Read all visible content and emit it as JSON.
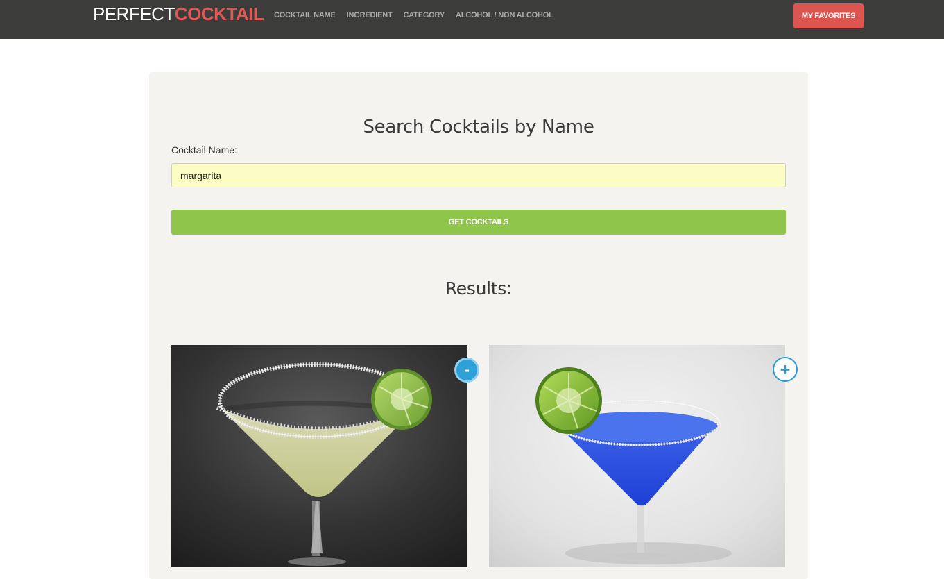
{
  "brand": {
    "part1": "PERFECT",
    "part2": "COCKTAIL"
  },
  "nav": {
    "items": [
      {
        "label": "COCKTAIL NAME"
      },
      {
        "label": "INGREDIENT"
      },
      {
        "label": "CATEGORY"
      },
      {
        "label": "ALCOHOL / NON ALCOHOL"
      }
    ],
    "favorites_label": "MY FAVORITES"
  },
  "search": {
    "title": "Search Cocktails by Name",
    "field_label": "Cocktail Name:",
    "value": "margarita",
    "button_label": "GET COCKTAILS"
  },
  "results": {
    "title": "Results:",
    "cards": [
      {
        "favorite_toggle": "-",
        "icon": "remove-favorite-icon"
      },
      {
        "favorite_toggle": "+",
        "icon": "add-favorite-icon"
      }
    ]
  },
  "colors": {
    "navbar": "#3c3c3a",
    "brand_accent": "#e05a55",
    "favorites_button": "#dc5550",
    "panel": "#f4f3f0",
    "input_bg": "#fbfdc4",
    "primary_button": "#8fc54a",
    "toggle_blue": "#2ea0d8"
  }
}
